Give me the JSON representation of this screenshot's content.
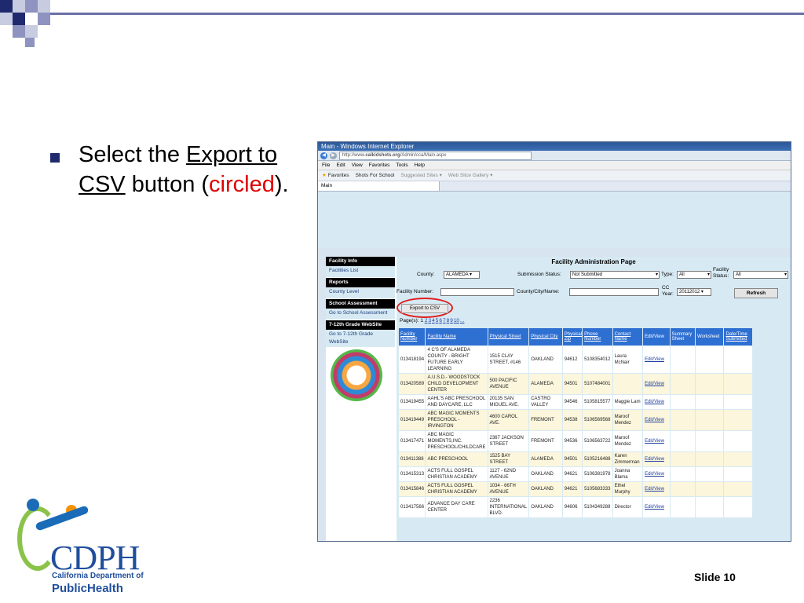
{
  "slide": {
    "bullet": {
      "part1": "Select the ",
      "link": "Export to CSV",
      "part2": " button (",
      "red": "circled",
      "part3": ")."
    },
    "slide_number": "Slide 10"
  },
  "logo": {
    "name": "CDPH",
    "sub1": "California Department of",
    "sub2a": "Public",
    "sub2b": "Health"
  },
  "browser": {
    "title": "Main - Windows Internet Explorer",
    "url_prefix": "http://www.",
    "url_bold": "calkidshots.org",
    "url_suffix": "/Admin/cca/Main.aspx",
    "menu": [
      "File",
      "Edit",
      "View",
      "Favorites",
      "Tools",
      "Help"
    ],
    "favorites": [
      "Favorites",
      "Shots For School",
      "Suggested Sites ▾",
      "Web Slice Gallery ▾"
    ],
    "tab": "Main"
  },
  "sidebar": {
    "h1": "Facility Info",
    "l1": "Facilities List",
    "h2": "Reports",
    "l2": "County Level",
    "h3": "School Assessment",
    "l3": "Go to School Assessment",
    "h4": "7-12th Grade WebSite",
    "l4": "Go to 7-12th Grade WebSite"
  },
  "page": {
    "title": "Facility Administration Page",
    "county_label": "County:",
    "county_value": "ALAMEDA",
    "submission_label": "Submission Status:",
    "submission_value": "Not Submitted",
    "type_label": "Type:",
    "type_value": "All",
    "facility_status_label1": "Facility",
    "facility_status_label2": "Status:",
    "facility_status_value": "All",
    "facility_number_label": "Facility Number:",
    "county_city_label": "County/City/Name:",
    "cc_year_label1": "CC",
    "cc_year_label2": "Year:",
    "cc_year_value": "20112012",
    "refresh": "Refresh",
    "export": "Export to CSV",
    "pager_label": "Page(s): 1",
    "pages": [
      "2",
      "3",
      "4",
      "5",
      "6",
      "7",
      "8",
      "9",
      "10",
      "..."
    ]
  },
  "table": {
    "headers": [
      "Facility Number",
      "Facility Name",
      "Physical Street",
      "Physical City",
      "Physical Zip",
      "Phone Number",
      "Contact Name",
      "Edit/View",
      "Summary Sheet",
      "Worksheet",
      "Date/Time Submitted"
    ],
    "rows": [
      [
        "013418194",
        "4 C'S OF ALAMEDA COUNTY - BRIGHT FUTURE EARLY LEARNING",
        "1515 CLAY STREET, #146",
        "OAKLAND",
        "94612",
        "5108354012",
        "Laura McNair",
        "Edit/View"
      ],
      [
        "013420589",
        "A.U.S.D.- WOODSTOCK CHILD DEVELOPMENT CENTER",
        "500 PACIFIC AVENUE",
        "ALAMEDA",
        "94501",
        "5107484001",
        "",
        "Edit/View"
      ],
      [
        "013419455",
        "AAHL'S ABC PRESCHOOL AND DAYCARE, LLC",
        "20135 SAN MIGUEL AVE.",
        "CASTRO VALLEY",
        "94546",
        "5105815577",
        "Maggie Lam",
        "Edit/View"
      ],
      [
        "013419449",
        "ABC MAGIC MOMENTS PRESCHOOL - IRVINGTON",
        "4600 CAROL AVE.",
        "FREMONT",
        "94538",
        "5106569568",
        "Maroof Mendez",
        "Edit/View"
      ],
      [
        "013417471",
        "ABC MAGIC MOMENTS,INC. PRESCHOOL/CHILDCARE",
        "2367 JACKSON STREET",
        "FREMONT",
        "94536",
        "5106563722",
        "Maroof Mendez",
        "Edit/View"
      ],
      [
        "013411388",
        "ABC PRESCHOOL",
        "1525 BAY STREET",
        "ALAMEDA",
        "94501",
        "5105216488",
        "Karen Zimmerman",
        "Edit/View"
      ],
      [
        "013415313",
        "ACTS FULL GOSPEL CHRISTIAN ACADEMY",
        "1127 - 62ND AVENUE",
        "OAKLAND",
        "94621",
        "5106381978",
        "Joanna Blama",
        "Edit/View"
      ],
      [
        "013415846",
        "ACTS FULL GOSPEL CHRISTIAN ACADEMY",
        "1034 - 66TH AVENUE",
        "OAKLAND",
        "94621",
        "5105683333",
        "Ethel Murphy",
        "Edit/View"
      ],
      [
        "013417566",
        "ADVANCE DAY CARE CENTER",
        "2236 INTERNATIONAL BLVD.",
        "OAKLAND",
        "94606",
        "5104349288",
        "Director",
        "Edit/View"
      ]
    ]
  }
}
